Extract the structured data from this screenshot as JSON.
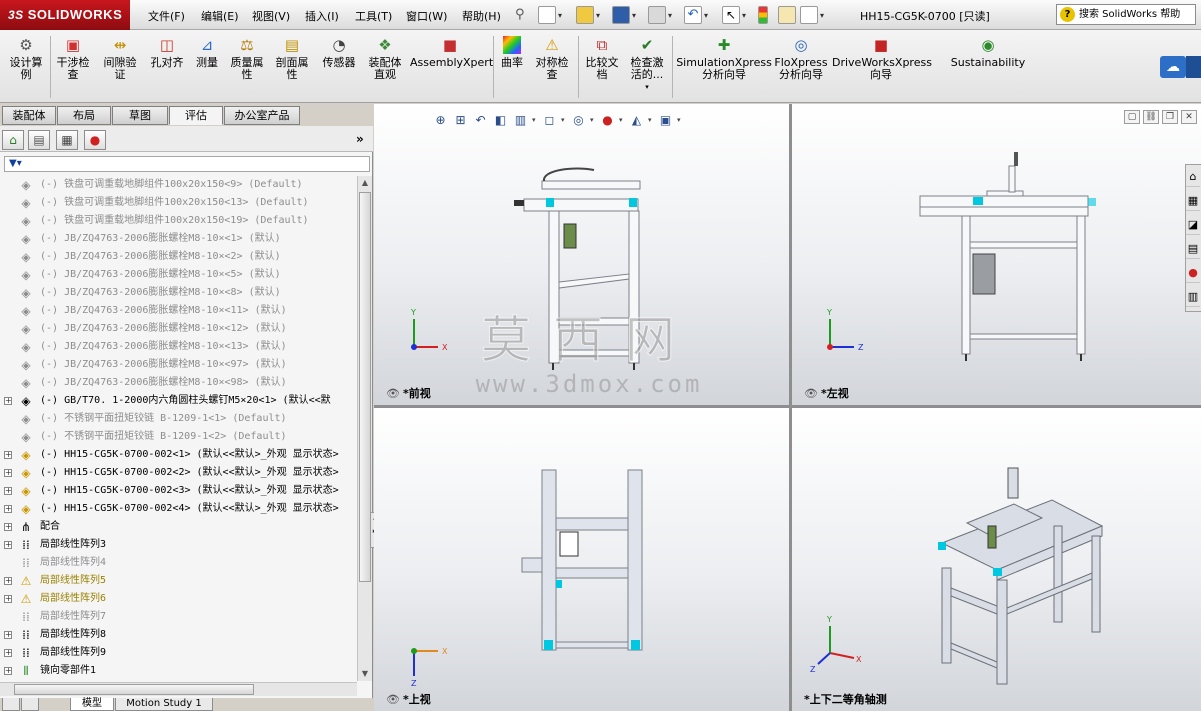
{
  "app": {
    "brand": "SOLIDWORKS",
    "brand_prefix": "3S",
    "doc_title": "HH15-CG5K-0700 [只读]",
    "help_placeholder": "搜索 SolidWorks 帮助"
  },
  "menu": [
    "文件(F)",
    "编辑(E)",
    "视图(V)",
    "插入(I)",
    "工具(T)",
    "窗口(W)",
    "帮助(H)"
  ],
  "ribbon": {
    "tools": [
      {
        "label": "设计算\n例",
        "icon": "design-study-icon"
      },
      {
        "label": "干涉检\n查",
        "icon": "interference-check-icon"
      },
      {
        "label": "间隙验\n证",
        "icon": "clearance-verify-icon"
      },
      {
        "label": "孔对齐",
        "icon": "hole-align-icon"
      },
      {
        "label": "测量",
        "icon": "measure-icon"
      },
      {
        "label": "质量属\n性",
        "icon": "mass-properties-icon"
      },
      {
        "label": "剖面属\n性",
        "icon": "section-properties-icon"
      },
      {
        "label": "传感器",
        "icon": "sensor-icon"
      },
      {
        "label": "装配体\n直观",
        "icon": "assembly-visualization-icon"
      },
      {
        "label": "AssemblyXpert",
        "icon": "assemblyxpert-icon"
      },
      {
        "label": "曲率",
        "icon": "curvature-icon"
      },
      {
        "label": "对称检\n查",
        "icon": "symmetry-check-icon"
      },
      {
        "label": "比较文\n档",
        "icon": "compare-documents-icon"
      },
      {
        "label": "检查激\n活的...",
        "icon": "check-active-icon"
      },
      {
        "label": "SimulationXpress\n分析向导",
        "icon": "simulationxpress-icon"
      },
      {
        "label": "FloXpress\n分析向导",
        "icon": "floxpress-icon"
      },
      {
        "label": "DriveWorksXpress\n向导",
        "icon": "driveworksxpress-icon"
      },
      {
        "label": "Sustainability",
        "icon": "sustainability-icon"
      }
    ]
  },
  "command_tabs": [
    "装配体",
    "布局",
    "草图",
    "评估",
    "办公室产品"
  ],
  "active_command_tab": "评估",
  "tree": {
    "rows": [
      {
        "text": "(-) 铁盘可调重载地脚组件100x20x150<9> (Default)",
        "state": "suppressed",
        "icon": "part-icon",
        "expand": false
      },
      {
        "text": "(-) 铁盘可调重载地脚组件100x20x150<13> (Default)",
        "state": "suppressed",
        "icon": "part-icon",
        "expand": false
      },
      {
        "text": "(-) 铁盘可调重载地脚组件100x20x150<19> (Default)",
        "state": "suppressed",
        "icon": "part-icon",
        "expand": false
      },
      {
        "text": "(-) JB/ZQ4763-2006膨胀螺栓M8-10×<1> (默认)",
        "state": "suppressed",
        "icon": "part-icon",
        "expand": false
      },
      {
        "text": "(-) JB/ZQ4763-2006膨胀螺栓M8-10×<2> (默认)",
        "state": "suppressed",
        "icon": "part-icon",
        "expand": false
      },
      {
        "text": "(-) JB/ZQ4763-2006膨胀螺栓M8-10×<5> (默认)",
        "state": "suppressed",
        "icon": "part-icon",
        "expand": false
      },
      {
        "text": "(-) JB/ZQ4763-2006膨胀螺栓M8-10×<8> (默认)",
        "state": "suppressed",
        "icon": "part-icon",
        "expand": false
      },
      {
        "text": "(-) JB/ZQ4763-2006膨胀螺栓M8-10×<11> (默认)",
        "state": "suppressed",
        "icon": "part-icon",
        "expand": false
      },
      {
        "text": "(-) JB/ZQ4763-2006膨胀螺栓M8-10×<12> (默认)",
        "state": "suppressed",
        "icon": "part-icon",
        "expand": false
      },
      {
        "text": "(-) JB/ZQ4763-2006膨胀螺栓M8-10×<13> (默认)",
        "state": "suppressed",
        "icon": "part-icon",
        "expand": false
      },
      {
        "text": "(-) JB/ZQ4763-2006膨胀螺栓M8-10×<97> (默认)",
        "state": "suppressed",
        "icon": "part-icon",
        "expand": false
      },
      {
        "text": "(-) JB/ZQ4763-2006膨胀螺栓M8-10×<98> (默认)",
        "state": "suppressed",
        "icon": "part-icon",
        "expand": false
      },
      {
        "text": "(-) GB/T70. 1-2000内六角圆柱头螺钉M5×20<1> (默认<<默",
        "state": "normal",
        "icon": "part-icon",
        "expand": true
      },
      {
        "text": "(-) 不锈钢平面扭矩铰链 B-1209-1<1> (Default)",
        "state": "suppressed",
        "icon": "part-icon",
        "expand": false
      },
      {
        "text": "(-) 不锈钢平面扭矩铰链 B-1209-1<2> (Default)",
        "state": "suppressed",
        "icon": "part-icon",
        "expand": false
      },
      {
        "text": "(-) HH15-CG5K-0700-002<1> (默认<<默认>_外观 显示状态>",
        "state": "part",
        "icon": "assembly-icon",
        "expand": true
      },
      {
        "text": "(-) HH15-CG5K-0700-002<2> (默认<<默认>_外观 显示状态>",
        "state": "part",
        "icon": "assembly-icon",
        "expand": true
      },
      {
        "text": "(-) HH15-CG5K-0700-002<3> (默认<<默认>_外观 显示状态>",
        "state": "part",
        "icon": "assembly-icon",
        "expand": true
      },
      {
        "text": "(-) HH15-CG5K-0700-002<4> (默认<<默认>_外观 显示状态>",
        "state": "part",
        "icon": "assembly-icon",
        "expand": true
      },
      {
        "text": "配合",
        "state": "normal",
        "icon": "mates-icon",
        "expand": true
      },
      {
        "text": "局部线性阵列3",
        "state": "normal",
        "icon": "linear-pattern-icon",
        "expand": true
      },
      {
        "text": "局部线性阵列4",
        "state": "suppressed",
        "icon": "linear-pattern-icon",
        "expand": false
      },
      {
        "text": "局部线性阵列5",
        "state": "warn",
        "icon": "warning-icon",
        "expand": true
      },
      {
        "text": "局部线性阵列6",
        "state": "warn",
        "icon": "warning-icon",
        "expand": true
      },
      {
        "text": "局部线性阵列7",
        "state": "suppressed",
        "icon": "linear-pattern-icon",
        "expand": false
      },
      {
        "text": "局部线性阵列8",
        "state": "normal",
        "icon": "linear-pattern-icon",
        "expand": true
      },
      {
        "text": "局部线性阵列9",
        "state": "normal",
        "icon": "linear-pattern-icon",
        "expand": true
      },
      {
        "text": "镜向零部件1",
        "state": "normal",
        "icon": "mirror-component-icon",
        "expand": true
      }
    ]
  },
  "bottom_tabs": [
    "",
    "",
    "模型",
    "Motion Study 1"
  ],
  "views": {
    "front": "*前视",
    "left": "*左视",
    "top": "*上视",
    "iso": "*上下二等角轴测"
  },
  "triad": {
    "x": "X",
    "y": "Y",
    "z": "Z"
  },
  "watermark": {
    "cn": "莫西网",
    "url": "www.3dmox.com"
  },
  "colors": {
    "brand": "#c8161d",
    "accent": "#00c8e0",
    "frame": "#c9ccd3",
    "triad_x": "#d42020",
    "triad_y": "#1e9a1e",
    "triad_z": "#1e2fd4",
    "warn": "#9a8200"
  }
}
